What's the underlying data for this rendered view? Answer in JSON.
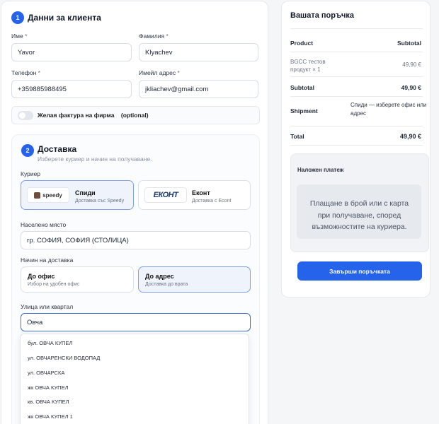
{
  "customer": {
    "step": "1",
    "title": "Данни за клиента",
    "first_name_label": "Име",
    "last_name_label": "Фамилия",
    "phone_label": "Телефон",
    "email_label": "Имейл адрес",
    "required_mark": "*",
    "first_name": "Yavor",
    "last_name": "Klyachev",
    "phone": "+359885988495",
    "email": "jkliachev@gmail.com",
    "invoice_label": "Желая фактура на фирма",
    "invoice_optional": "(optional)"
  },
  "delivery": {
    "step": "2",
    "title": "Доставка",
    "subtitle": "Изберете куриер и начин на получаване.",
    "courier_label": "Куриер",
    "couriers": [
      {
        "logo": "speedy",
        "name": "Спиди",
        "desc": "Доставка със Speedy",
        "selected": true
      },
      {
        "logo": "ЕКОНТ",
        "name": "Еконт",
        "desc": "Доставка с Econt",
        "selected": false
      }
    ],
    "city_label": "Населено място",
    "city": "гр. СОФИЯ, СОФИЯ (СТОЛИЦА)",
    "method_label": "Начин на доставка",
    "methods": [
      {
        "name": "До офис",
        "desc": "Избор на удобен офис",
        "selected": false
      },
      {
        "name": "До адрес",
        "desc": "Доставка до врата",
        "selected": true
      }
    ],
    "street_label": "Улица или квартал",
    "street": "Овча",
    "suggestions": [
      "бул. ОВЧА КУПЕЛ",
      "ул. ОВЧАРЕНСКИ ВОДОПАД",
      "ул. ОВЧАРСКА",
      "жк ОВЧА КУПЕЛ",
      "кв. ОВЧА КУПЕЛ",
      "жк ОВЧА КУПЕЛ 1"
    ]
  },
  "order": {
    "title": "Вашата поръчка",
    "product_header": "Product",
    "subtotal_header": "Subtotal",
    "item_name": "BGCC тестов продукт",
    "item_qty": "× 1",
    "item_price": "49,90 €",
    "subtotal_label": "Subtotal",
    "subtotal_value": "49,90 €",
    "shipment_label": "Shipment",
    "shipment_value": "Спиди — изберете офис или адрес",
    "total_label": "Total",
    "total_value": "49,90 €",
    "payment_title": "Наложен платеж",
    "payment_desc": "Плащане в брой или с карта при получаване, според възможностите на куриера.",
    "submit_label": "Завърши поръчката"
  },
  "colors": {
    "accent": "#2563eb",
    "selected_bg": "#eef3fc",
    "selected_border": "#7ea2e6"
  }
}
